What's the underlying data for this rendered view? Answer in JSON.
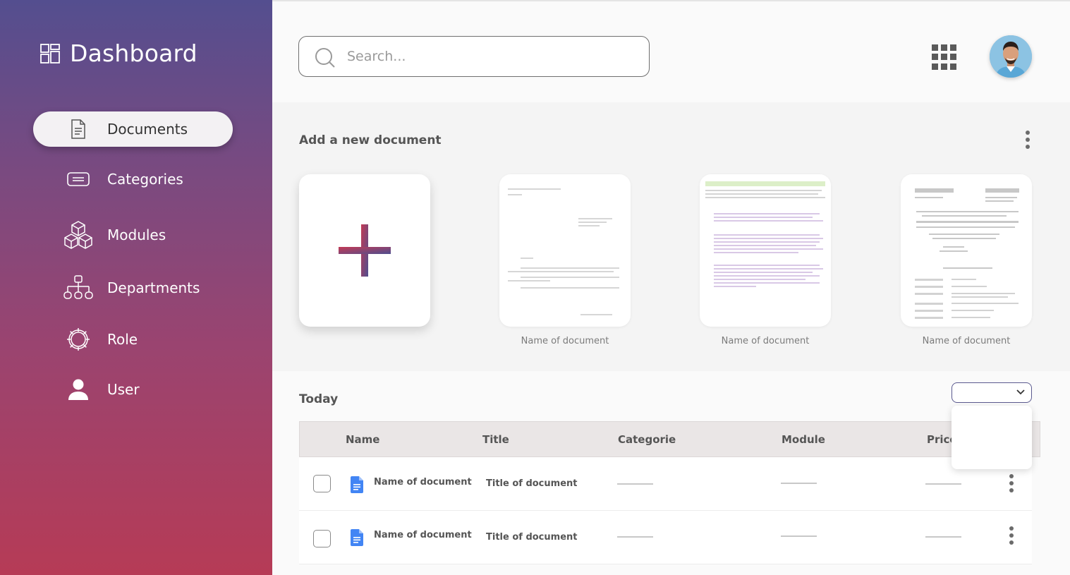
{
  "sidebar": {
    "brand_title": "Dashboard",
    "brand_icon": "dashboard-grid-icon",
    "items": [
      {
        "label": "Documents",
        "icon": "document-icon",
        "active": true
      },
      {
        "label": "Categories",
        "icon": "list-card-icon",
        "active": false
      },
      {
        "label": "Modules",
        "icon": "cubes-icon",
        "active": false
      },
      {
        "label": "Departments",
        "icon": "hierarchy-icon",
        "active": false
      },
      {
        "label": "Role",
        "icon": "gear-icon",
        "active": false
      },
      {
        "label": "User",
        "icon": "user-icon",
        "active": false
      }
    ]
  },
  "header": {
    "search_placeholder": "Search...",
    "apps_icon": "apps-grid-icon",
    "avatar_icon": "user-avatar"
  },
  "add_section": {
    "title": "Add a new document",
    "add_icon": "plus-icon",
    "documents": [
      {
        "caption": "Name of document"
      },
      {
        "caption": "Name of document"
      },
      {
        "caption": "Name of document"
      }
    ]
  },
  "today": {
    "title": "Today",
    "filter_value": "",
    "columns": [
      "Name",
      "Title",
      "Categorie",
      "Module",
      "Price"
    ],
    "rows": [
      {
        "name": "Name of document",
        "title": "Title of document",
        "categorie": "",
        "module": "",
        "price": ""
      },
      {
        "name": "Name of document",
        "title": "Title of document",
        "categorie": "",
        "module": "",
        "price": ""
      }
    ]
  },
  "colors": {
    "sidebar_top": "#544e8f",
    "sidebar_bottom": "#b63b56",
    "plus_red": "#c23a55",
    "plus_purple": "#4f4e8f",
    "doc_blue": "#4285f4"
  }
}
